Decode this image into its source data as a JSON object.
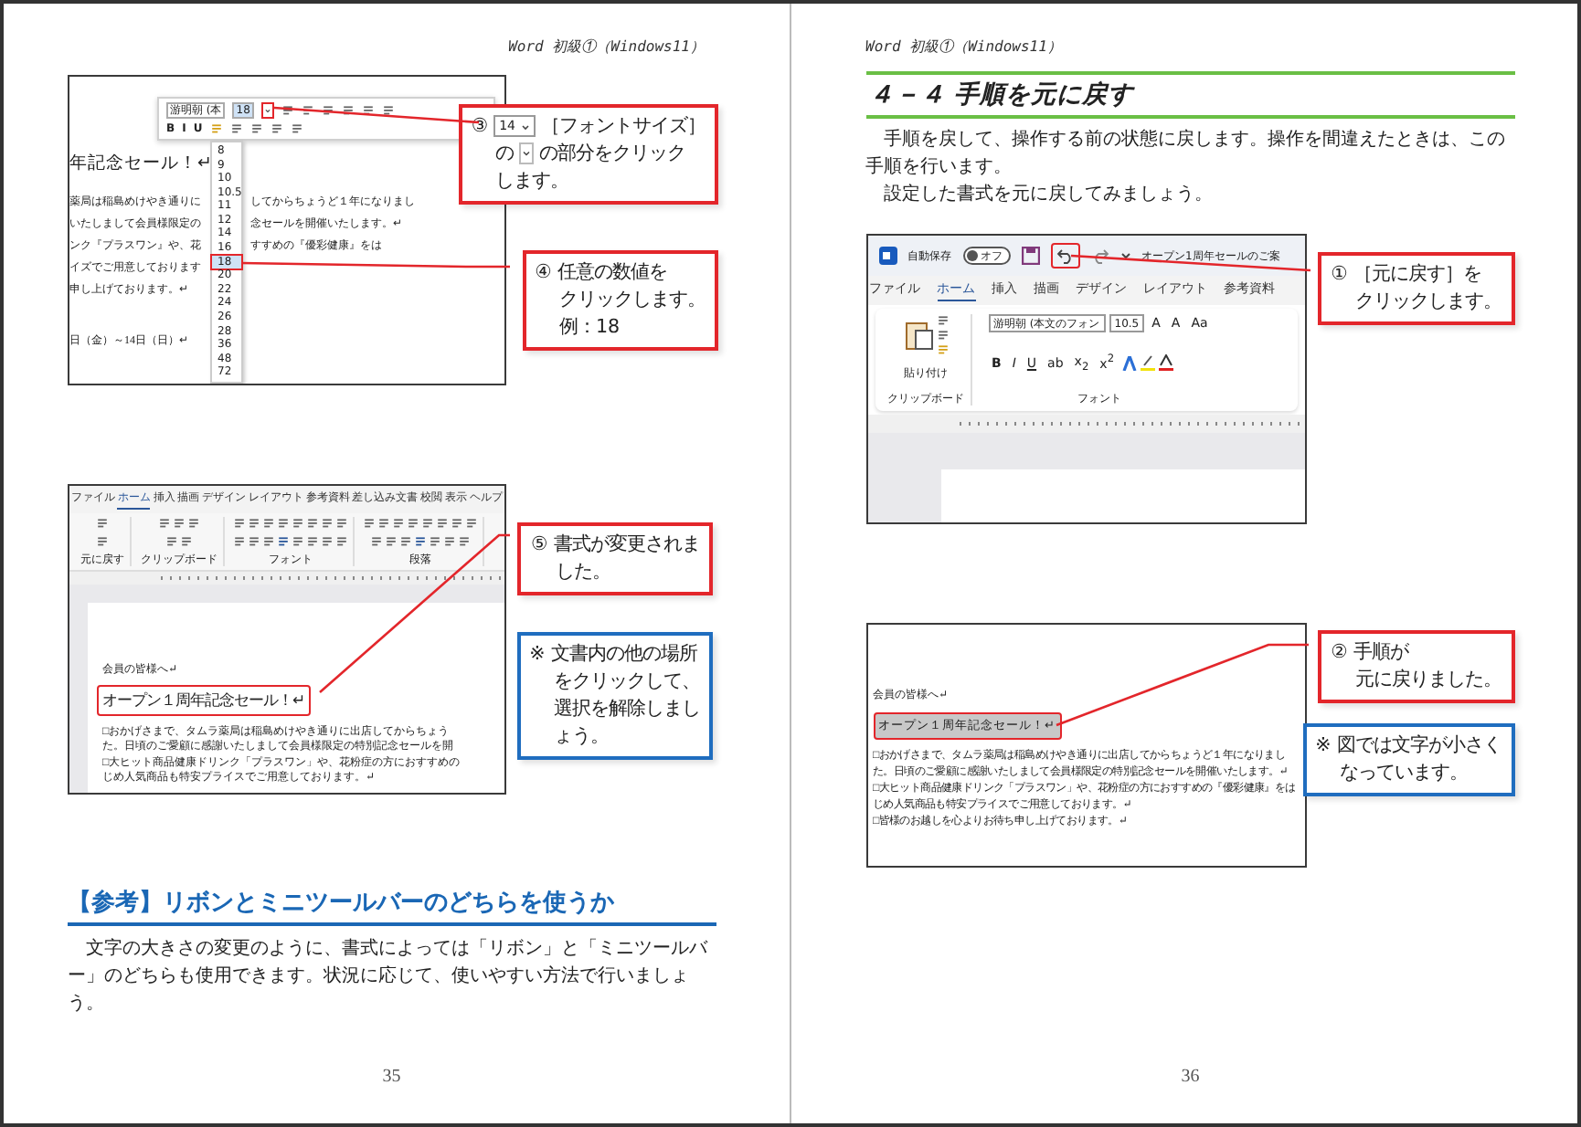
{
  "pages": [
    {
      "header": "Word 初級①（Windows11）",
      "page_number": "35",
      "blocks": [
        {
          "kind": "figure",
          "screenshot": {
            "kind": "font_size_menu",
            "toolbar_font": "游明朝 (本",
            "toolbar_size": "18",
            "toolbar_buttons": [
              "B",
              "I",
              "U"
            ],
            "heading": "年記念セール！↵",
            "lines": [
              {
                "left": "薬局は稲島めけやき通りに",
                "right": "してからちょうど１年になりまし"
              },
              {
                "left": "いたしまして会員様限定の",
                "right": "念セールを開催いたします。↵"
              },
              {
                "left": "ンク『プラスワン』や、花",
                "right": "すすめの『優彩健康』をは"
              },
              {
                "left": "イズでご用意しております"
              },
              {
                "left": "申し上げております。↵"
              }
            ],
            "date": "日（金）～14日（日）↵",
            "sizes": [
              {
                "text": "8",
                "selected": false
              },
              {
                "text": "9",
                "selected": false
              },
              {
                "text": "10",
                "selected": false
              },
              {
                "text": "10.5",
                "selected": false
              },
              {
                "text": "11",
                "selected": false
              },
              {
                "text": "12",
                "selected": false
              },
              {
                "text": "14",
                "selected": false
              },
              {
                "text": "16",
                "selected": false
              },
              {
                "text": "18",
                "selected": true
              },
              {
                "text": "20",
                "selected": false
              },
              {
                "text": "22",
                "selected": false
              },
              {
                "text": "24",
                "selected": false
              },
              {
                "text": "26",
                "selected": false
              },
              {
                "text": "28",
                "selected": false
              },
              {
                "text": "36",
                "selected": false
              },
              {
                "text": "48",
                "selected": false
              },
              {
                "text": "72",
                "selected": false
              }
            ]
          },
          "callouts": [
            {
              "kind": "step",
              "segments": [
                [
                  {
                    "kind": "text",
                    "text": "③"
                  },
                  {
                    "kind": "size_field",
                    "text": "14"
                  },
                  {
                    "kind": "text",
                    "text": "［フォントサイズ］"
                  }
                ],
                [
                  {
                    "kind": "text",
                    "text": "の"
                  },
                  {
                    "kind": "dropdown"
                  },
                  {
                    "kind": "text",
                    "text": "の部分をクリック"
                  }
                ],
                [
                  {
                    "kind": "text",
                    "text": "します。"
                  }
                ]
              ]
            },
            {
              "kind": "step",
              "lines": [
                "④ 任意の数値を",
                "クリックします。",
                "例：18"
              ]
            }
          ]
        },
        {
          "kind": "figure",
          "screenshot": {
            "kind": "ribbon_result",
            "tabs": [
              {
                "label": "ファイル",
                "selected": false
              },
              {
                "label": "ホーム",
                "selected": true
              },
              {
                "label": "挿入",
                "selected": false
              },
              {
                "label": "描画",
                "selected": false
              },
              {
                "label": "デザイン",
                "selected": false
              },
              {
                "label": "レイアウト",
                "selected": false
              },
              {
                "label": "参考資料",
                "selected": false
              },
              {
                "label": "差し込み文書",
                "selected": false
              },
              {
                "label": "校閲",
                "selected": false
              },
              {
                "label": "表示",
                "selected": false
              },
              {
                "label": "ヘルプ",
                "selected": false
              }
            ],
            "groups": [
              "元に戻す",
              "クリップボード",
              "フォント",
              "段落"
            ],
            "greeting": "会員の皆様へ↵",
            "heading": "オープン１周年記念セール！↵",
            "lines": [
              "□おかげさまで、タムラ薬局は稲島めけやき通りに出店してからちょう",
              "た。日頃のご愛顧に感謝いたしまして会員様限定の特別記念セールを開",
              "□大ヒット商品健康ドリンク「プラスワン」や、花粉症の方におすすめの",
              "じめ人気商品も特安プライスでご用意しております。↵"
            ]
          },
          "callouts": [
            {
              "kind": "step",
              "lines": [
                "⑤ 書式が変更されま",
                "した。"
              ]
            },
            {
              "kind": "note",
              "lines": [
                "※ 文書内の他の場所",
                "をクリックして、",
                "選択を解除しまし",
                "ょう。"
              ]
            }
          ]
        },
        {
          "kind": "reference_heading",
          "text": "【参考】リボンとミニツールバーのどちらを使うか"
        },
        {
          "kind": "paragraphs",
          "texts": [
            "文字の大きさの変更のように、書式によっては「リボン」と「ミニツールバー」のどちらも使用できます。状況に応じて、使いやすい方法で行いましょう。"
          ]
        }
      ]
    },
    {
      "header": "Word 初級①（Windows11）",
      "page_number": "36",
      "blocks": [
        {
          "kind": "section_heading",
          "text": "４－４ 手順を元に戻す"
        },
        {
          "kind": "paragraphs",
          "texts": [
            "手順を戻して、操作する前の状態に戻します。操作を間違えたときは、この手順を行います。",
            "設定した書式を元に戻してみましょう。"
          ]
        },
        {
          "kind": "figure",
          "screenshot": {
            "kind": "undo_button",
            "autosave": "自動保存",
            "autosave_on": false,
            "toggle_label": "オフ",
            "title": "オープン1周年セールのご案",
            "tabs": [
              {
                "label": "ファイル",
                "selected": false
              },
              {
                "label": "ホーム",
                "selected": true
              },
              {
                "label": "挿入",
                "selected": false
              },
              {
                "label": "描画",
                "selected": false
              },
              {
                "label": "デザイン",
                "selected": false
              },
              {
                "label": "レイアウト",
                "selected": false
              },
              {
                "label": "参考資料",
                "selected": false
              }
            ],
            "paste_label": "貼り付け",
            "clipboard_label": "クリップボード",
            "font_name": "游明朝 (本文のフォン",
            "font_size": "10.5",
            "size_buttons": [
              "A",
              "A",
              "Aa"
            ],
            "format_buttons": [
              "B",
              "I",
              "U",
              "ab",
              "x$_{2}$",
              "x$^{2}$"
            ],
            "font_label": "フォント"
          },
          "callouts": [
            {
              "kind": "step",
              "lines": [
                "① ［元に戻す］を",
                "クリックします。"
              ]
            }
          ]
        },
        {
          "kind": "figure",
          "screenshot": {
            "kind": "reverted_text",
            "greeting": "会員の皆様へ↵",
            "heading": "オープン１周年記念セール！↵",
            "lines": [
              "□おかげさまで、タムラ薬局は稲島めけやき通りに出店してからちょうど１年になりまし",
              "た。日頃のご愛顧に感謝いたしまして会員様限定の特別記念セールを開催いたします。↵",
              "□大ヒット商品健康ドリンク「プラスワン」や、花粉症の方におすすめの『優彩健康』をは",
              "じめ人気商品も特安プライスでご用意しております。↵",
              "□皆様のお越しを心よりお待ち申し上げております。↵"
            ]
          },
          "callouts": [
            {
              "kind": "step",
              "lines": [
                "② 手順が",
                "元に戻りました。"
              ]
            },
            {
              "kind": "note",
              "lines": [
                "※ 図では文字が小さく",
                "なっています。"
              ]
            }
          ]
        }
      ]
    }
  ]
}
